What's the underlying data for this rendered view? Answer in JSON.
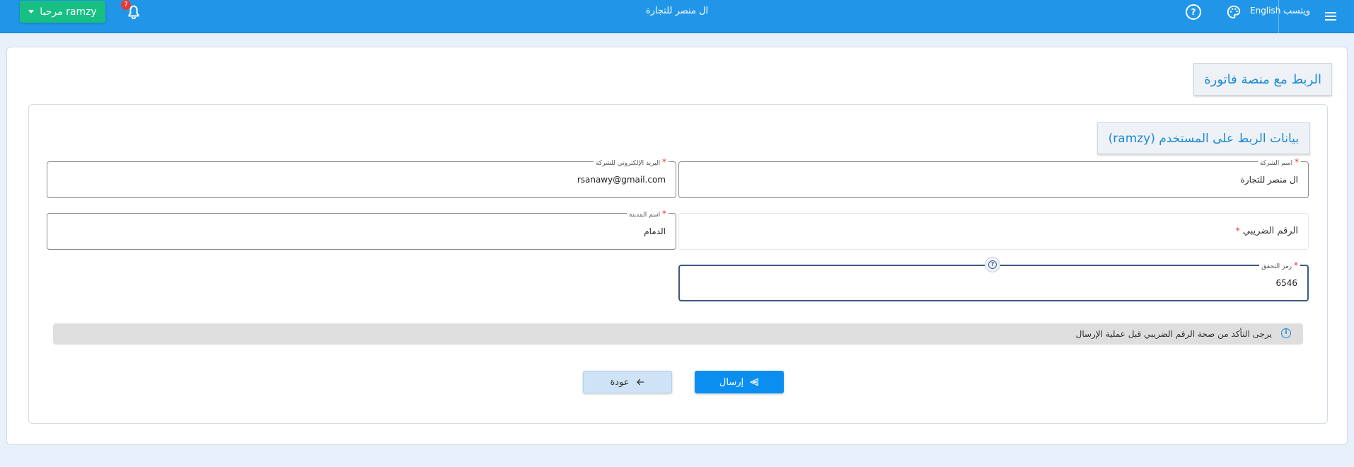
{
  "header": {
    "app_title": "ال منصر للتجارة",
    "whatsapp_label": "ويتسب",
    "language_label": "English",
    "notifications_count": "7",
    "user_greeting": "مرحبا ramzy"
  },
  "page": {
    "heading": "الربط مع منصة فاتورة"
  },
  "section": {
    "heading": "بيانات الربط على المستخدم (ramzy)"
  },
  "form": {
    "company_name": {
      "label": "اسم الشركة",
      "value": "ال منصر للتجارة"
    },
    "company_email": {
      "label": "البريد الإلكتروني للشركة",
      "value": "rsanawy@gmail.com"
    },
    "tax_number": {
      "label": "الرقم الضريبي",
      "value": ""
    },
    "city_name": {
      "label": "اسم المدينة",
      "value": "الدمام"
    },
    "verification_code": {
      "label": "رمز التحقق",
      "value": "6546"
    },
    "required_mark": "*"
  },
  "notice": {
    "text": "يرجى التأكد من صحة الرقم الضريبي قبل عملية الإرسال"
  },
  "actions": {
    "send_label": "إرسال",
    "back_label": "عودة"
  },
  "colors": {
    "topbar": "#2196e9",
    "user_button": "#17c082",
    "accent": "#1b8ad6",
    "send_button": "#0a8ff0"
  }
}
